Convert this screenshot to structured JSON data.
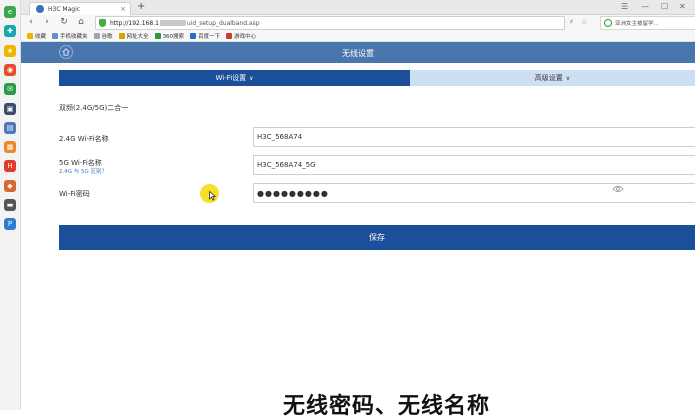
{
  "browser": {
    "tab_title": "H3C Magic",
    "tab_close": "×",
    "new_tab": "+",
    "url_prefix": "http://192.168.1",
    "url_suffix": "uid_setup_dualband.asp",
    "search_text": "亚洲女主被留学..."
  },
  "bookmarks": [
    {
      "label": "收藏",
      "color": "#f5b400"
    },
    {
      "label": "手机收藏夹",
      "color": "#6a8fd0"
    },
    {
      "label": "谷歌",
      "color": "#9aa5b5"
    },
    {
      "label": "网址大全",
      "color": "#e0a000"
    },
    {
      "label": "360搜索",
      "color": "#2b9b3b"
    },
    {
      "label": "百度一下",
      "color": "#2b6ad0"
    },
    {
      "label": "游戏中心",
      "color": "#d43a2a"
    }
  ],
  "sidebar_icons": [
    {
      "name": "ie-icon",
      "glyph": "e",
      "color": "#3aa84a"
    },
    {
      "name": "app-icon-teal",
      "glyph": "✚",
      "color": "#1aa6b0"
    },
    {
      "name": "star-icon",
      "glyph": "★",
      "color": "#f1b500"
    },
    {
      "name": "weibo-icon",
      "glyph": "◉",
      "color": "#e54d2e"
    },
    {
      "name": "mail-icon",
      "glyph": "✉",
      "color": "#2c9b46"
    },
    {
      "name": "app-icon-dark",
      "glyph": "▣",
      "color": "#3b4b6b"
    },
    {
      "name": "doc-icon",
      "glyph": "▤",
      "color": "#4e78b8"
    },
    {
      "name": "gift-icon",
      "glyph": "▦",
      "color": "#e88a2a"
    },
    {
      "name": "hot-icon",
      "glyph": "H",
      "color": "#e03a2a"
    },
    {
      "name": "game-icon",
      "glyph": "◆",
      "color": "#d9662a"
    },
    {
      "name": "monitor-icon",
      "glyph": "▬",
      "color": "#555555"
    },
    {
      "name": "p-icon",
      "glyph": "P",
      "color": "#2d7dd2"
    }
  ],
  "page": {
    "header_title": "无线设置",
    "tabs": [
      {
        "label": "Wi-Fi设置",
        "active": true
      },
      {
        "label": "高级设置",
        "active": false
      }
    ],
    "dualband_label": "双频(2.4G/5G)二合一",
    "fields": {
      "ssid_24g": {
        "label": "2.4G Wi-Fi名称",
        "value": "H3C_568A74"
      },
      "ssid_5g": {
        "label": "5G Wi-Fi名称",
        "sub": "2.4G 与 5G 区别？",
        "value": "H3C_568A74_5G"
      },
      "password": {
        "label": "Wi-Fi密码",
        "value": "●●●●●●●●●"
      }
    },
    "save_label": "保存"
  },
  "caption": "无线密码、无线名称",
  "colors": {
    "header_band": "#4a76ae",
    "primary": "#1b4f9a",
    "tab_inactive": "#cfdff3",
    "cursor_highlight": "#f4e026"
  }
}
